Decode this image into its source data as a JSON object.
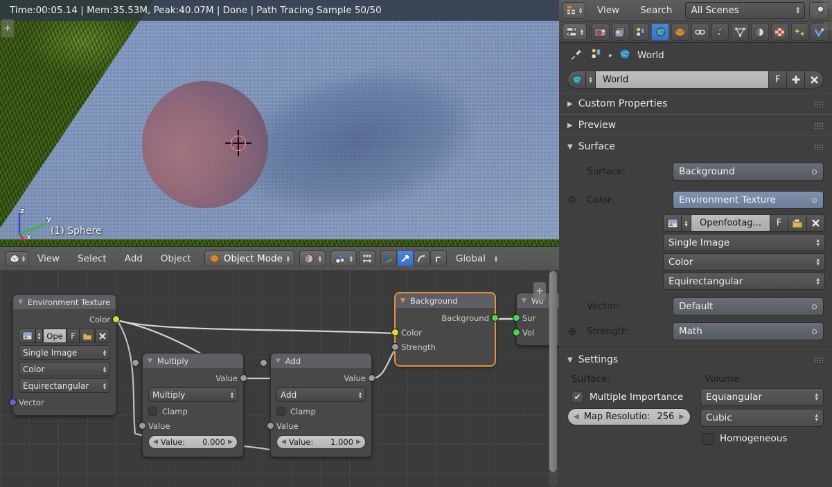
{
  "viewport": {
    "render_info": "Time:00:05.14 | Mem:35.53M, Peak:40.07M | Done | Path Tracing Sample 50/50",
    "object_label": "(1) Sphere",
    "axis_labels": {
      "z": "z",
      "y": "y",
      "x": "x"
    },
    "plus_tab": "+"
  },
  "node_header": {
    "editor_icon": "editor-type-3dview-icon",
    "menus": [
      "View",
      "Select",
      "Add",
      "Object"
    ],
    "mode": "Object Mode",
    "shading_icon": "viewport-shading-icon",
    "snap_icon": "snap-magnet-icon",
    "pivot_icon": "pivot-point-icon",
    "manipulator_icons": [
      "translate-manipulator-icon",
      "rotate-manipulator-icon",
      "scale-manipulator-icon"
    ],
    "orientation": "Global",
    "plus_tab": "+"
  },
  "nodes": [
    {
      "title": "Environment Texture",
      "selected": false,
      "outputs": [
        {
          "label": "Color",
          "color": "yellow"
        }
      ],
      "image_row": {
        "name": "Ope",
        "f_label": "F",
        "open_icon": "open-folder-icon",
        "x_label": "x"
      },
      "dropdowns": [
        "Single Image",
        "Color",
        "Equirectangular"
      ],
      "inputs": [
        {
          "label": "Vector",
          "color": "purple"
        }
      ]
    },
    {
      "title": "Multiply",
      "selected": false,
      "outputs": [
        {
          "label": "Value",
          "color": "gray"
        }
      ],
      "operation": "Multiply",
      "clamp_label": "Clamp",
      "clamp_checked": false,
      "inputs": [
        {
          "label": "Value",
          "color": "gray"
        }
      ],
      "value_field": {
        "label": "Value:",
        "value": "0.000"
      }
    },
    {
      "title": "Add",
      "selected": false,
      "outputs": [
        {
          "label": "Value",
          "color": "gray"
        }
      ],
      "operation": "Add",
      "clamp_label": "Clamp",
      "clamp_checked": false,
      "inputs": [
        {
          "label": "Value",
          "color": "gray"
        }
      ],
      "value_field": {
        "label": "Value:",
        "value": "1.000"
      }
    },
    {
      "title": "Background",
      "selected": true,
      "outputs": [
        {
          "label": "Background",
          "color": "green"
        }
      ],
      "inputs": [
        {
          "label": "Color",
          "color": "yellow"
        },
        {
          "label": "Strength",
          "color": "gray"
        }
      ]
    },
    {
      "title": "Wo",
      "selected": false,
      "inputs": [
        {
          "label": "Sur",
          "color": "green"
        },
        {
          "label": "Vol",
          "color": "green"
        }
      ]
    }
  ],
  "properties": {
    "header": {
      "editor_icon": "editor-type-outliner-icon",
      "menus": [
        "View",
        "Search"
      ],
      "scene_filter": "All Scenes",
      "search_icon": "magnifier-icon"
    },
    "tabs": [
      {
        "name": "render-tab",
        "icon": "camera-back-icon",
        "active": false
      },
      {
        "name": "render-layers-tab",
        "icon": "render-layers-icon",
        "active": false
      },
      {
        "name": "scene-tab",
        "icon": "scene-icon",
        "active": false
      },
      {
        "name": "world-tab",
        "icon": "world-globe-icon",
        "active": true
      },
      {
        "name": "object-tab",
        "icon": "object-cube-icon",
        "active": false
      },
      {
        "name": "constraints-tab",
        "icon": "chain-link-icon",
        "active": false
      },
      {
        "name": "modifiers-tab",
        "icon": "wrench-icon",
        "active": false
      },
      {
        "name": "data-tab",
        "icon": "mesh-data-icon",
        "active": false
      },
      {
        "name": "material-tab",
        "icon": "material-sphere-icon",
        "active": false
      },
      {
        "name": "texture-tab",
        "icon": "checker-texture-icon",
        "active": false
      },
      {
        "name": "particles-tab",
        "icon": "particles-icon",
        "active": false
      },
      {
        "name": "physics-tab",
        "icon": "physics-icon",
        "active": false
      }
    ],
    "breadcrumb": {
      "pin_icon": "pin-icon",
      "scene_icon": "scene-icon",
      "separator": "▸",
      "world_icon": "world-globe-icon",
      "world_label": "World"
    },
    "id_block": {
      "icon": "world-globe-icon",
      "name": "World",
      "fake_user": "F",
      "new_label": "+",
      "unlink_label": "✕"
    },
    "panels": {
      "custom_properties": {
        "label": "Custom Properties",
        "expanded": false
      },
      "preview": {
        "label": "Preview",
        "expanded": false
      },
      "surface": {
        "label": "Surface",
        "expanded": true
      },
      "settings": {
        "label": "Settings",
        "expanded": true
      }
    },
    "surface": {
      "rows": [
        {
          "label": "Surface:",
          "value": "Background",
          "expander": "",
          "highlight": false
        },
        {
          "label": "Color:",
          "value": "Environment Texture",
          "expander": "⊖",
          "highlight": true
        }
      ],
      "image_row": {
        "icon": "image-datablock-icon",
        "name": "Openfootag...",
        "fake_user": "F",
        "open_icon": "open-folder-icon",
        "unlink_label": "✕"
      },
      "dropdowns": [
        "Single Image",
        "Color",
        "Equirectangular"
      ],
      "vector": {
        "label": "Vector:",
        "value": "Default"
      },
      "strength": {
        "label": "Strength:",
        "value": "Math",
        "expander": "⊕"
      }
    },
    "settings": {
      "surface_title": "Surface:",
      "volume_title": "Volume:",
      "multiple_importance": {
        "label": "Multiple Importance",
        "checked": true
      },
      "map_resolution": {
        "label": "Map Resolutio:",
        "value": "256"
      },
      "volume_sampling": "Equiangular",
      "volume_interpolation": "Cubic",
      "homogeneous": {
        "label": "Homogeneous",
        "checked": false
      }
    }
  },
  "colors": {
    "accent_blue": "#4d87d8",
    "node_selected": "#e8913a",
    "socket_yellow": "#dede36",
    "socket_green": "#49d649",
    "socket_purple": "#6363d6",
    "socket_gray": "#9c9c9c",
    "panel_bg": "#3f3f3f"
  }
}
